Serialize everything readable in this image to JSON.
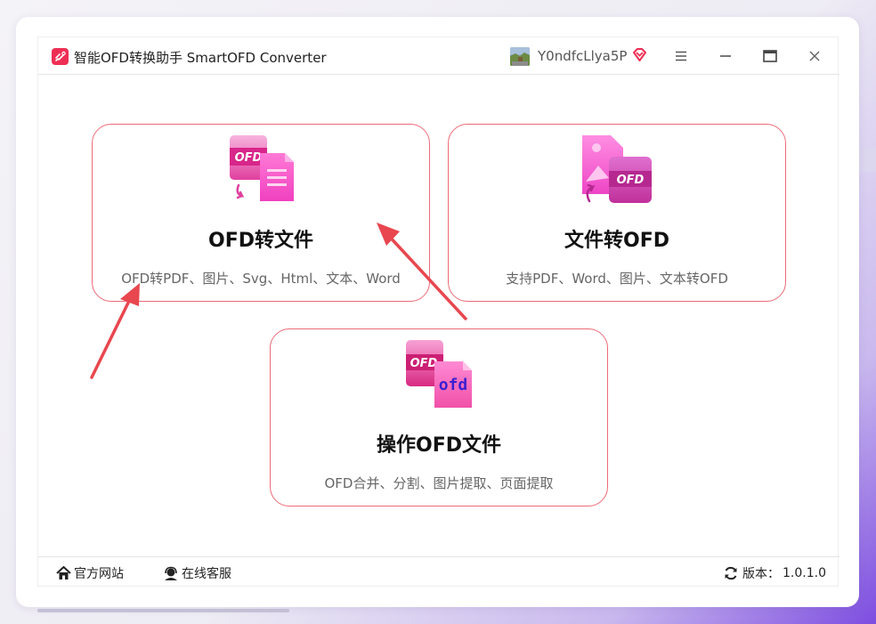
{
  "window": {
    "title": "智能OFD转换助手 SmartOFD Converter",
    "username": "Y0ndfcLlya5P"
  },
  "cards": [
    {
      "title": "OFD转文件",
      "desc": "OFD转PDF、图片、Svg、Html、文本、Word",
      "icon": "ofd-to-file-icon",
      "badge": "OFD"
    },
    {
      "title": "文件转OFD",
      "desc": "支持PDF、Word、图片、文本转OFD",
      "icon": "file-to-ofd-icon",
      "badge": "OFD"
    },
    {
      "title": "操作OFD文件",
      "desc": "OFD合并、分割、图片提取、页面提取",
      "icon": "ofd-operate-icon",
      "badge": "OFD",
      "badge2": "ofd"
    }
  ],
  "footer": {
    "official_site": "官方网站",
    "online_service": "在线客服",
    "version_label": "版本：",
    "version": "1.0.1.0"
  },
  "colors": {
    "accent": "#ee2f55",
    "card_border": "#ec6b78",
    "icon_pink": "#f060c8",
    "icon_magenta": "#d63a9a",
    "arrow": "#e8474f"
  }
}
